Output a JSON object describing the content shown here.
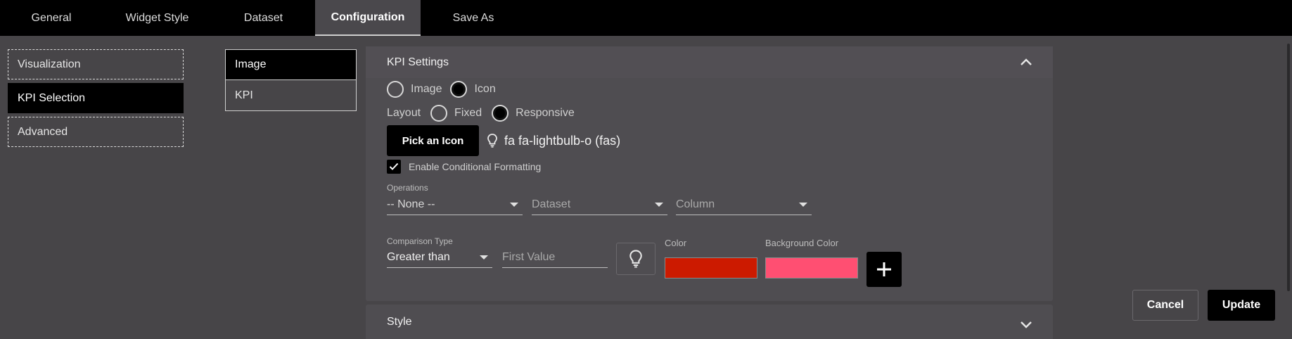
{
  "tabs": [
    {
      "label": "General"
    },
    {
      "label": "Widget Style"
    },
    {
      "label": "Dataset"
    },
    {
      "label": "Configuration",
      "active": true
    },
    {
      "label": "Save As"
    }
  ],
  "left_nav": {
    "items": [
      {
        "label": "Visualization"
      },
      {
        "label": "KPI Selection",
        "selected": true
      },
      {
        "label": "Advanced"
      }
    ]
  },
  "mid_list": {
    "items": [
      {
        "label": "Image",
        "selected": true
      },
      {
        "label": "KPI"
      }
    ]
  },
  "kpi_settings": {
    "title": "KPI Settings",
    "source_options": [
      {
        "label": "Image",
        "checked": false
      },
      {
        "label": "Icon",
        "checked": true
      }
    ],
    "layout_label": "Layout",
    "layout_options": [
      {
        "label": "Fixed",
        "checked": false
      },
      {
        "label": "Responsive",
        "checked": true
      }
    ],
    "pick_icon_label": "Pick an Icon",
    "icon_value": "fa fa-lightbulb-o (fas)",
    "conditional_formatting_label": "Enable Conditional Formatting",
    "conditional_formatting_checked": true,
    "operations_label": "Operations",
    "operations_value": "-- None --",
    "dataset_placeholder": "Dataset",
    "column_placeholder": "Column",
    "comparison_type_label": "Comparison Type",
    "comparison_type_value": "Greater than",
    "first_value_placeholder": "First Value",
    "color_label": "Color",
    "color_value": "#cc1a00",
    "background_color_label": "Background Color",
    "background_color_value": "#ff4f72"
  },
  "style_panel": {
    "title": "Style"
  },
  "actions": {
    "cancel_label": "Cancel",
    "update_label": "Update"
  }
}
